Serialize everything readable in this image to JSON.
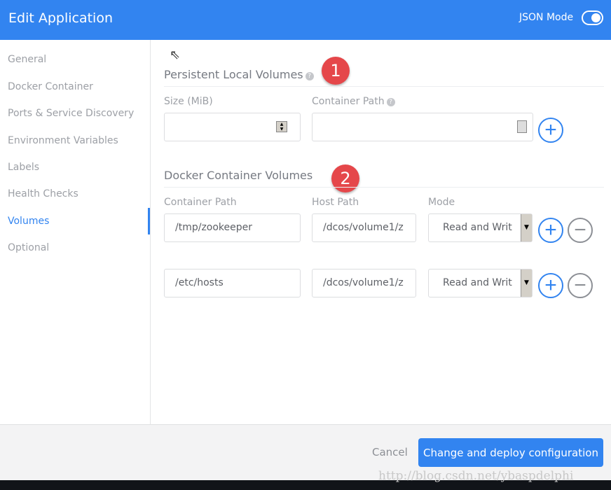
{
  "header": {
    "title": "Edit Application",
    "json_mode_label": "JSON Mode",
    "json_mode_on": false
  },
  "sidebar": {
    "items": [
      {
        "label": "General"
      },
      {
        "label": "Docker Container"
      },
      {
        "label": "Ports & Service Discovery"
      },
      {
        "label": "Environment Variables"
      },
      {
        "label": "Labels"
      },
      {
        "label": "Health Checks"
      },
      {
        "label": "Volumes",
        "active": true
      },
      {
        "label": "Optional"
      }
    ]
  },
  "persistent": {
    "title": "Persistent Local Volumes",
    "badge": "1",
    "size_label": "Size (MiB)",
    "path_label": "Container Path",
    "size_value": "",
    "path_value": ""
  },
  "docker": {
    "title": "Docker Container Volumes",
    "badge": "2",
    "col_container": "Container Path",
    "col_host": "Host Path",
    "col_mode": "Mode",
    "rows": [
      {
        "container_path": "/tmp/zookeeper",
        "host_path": "/dcos/volume1/z",
        "mode": "Read and Writ"
      },
      {
        "container_path": "/etc/hosts",
        "host_path": "/dcos/volume1/z",
        "mode": "Read and Writ"
      }
    ]
  },
  "footer": {
    "cancel": "Cancel",
    "deploy": "Change and deploy configuration"
  },
  "watermark": "http://blog.csdn.net/ybaspdelphi",
  "colors": {
    "accent": "#3284f0",
    "badge": "#e5474a"
  }
}
